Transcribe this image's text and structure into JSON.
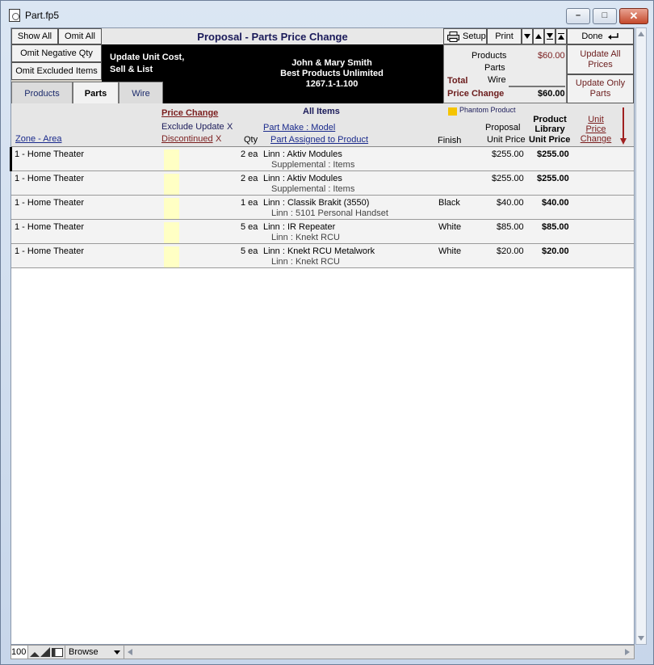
{
  "window": {
    "title": "Part.fp5",
    "min_glyph": "–",
    "max_glyph": "□",
    "close_glyph": "✕"
  },
  "toolbar": {
    "show_all": "Show All",
    "omit_all": "Omit All",
    "omit_negative": "Omit Negative Qty",
    "omit_excluded": "Omit Excluded Items",
    "title": "Proposal - Parts Price Change",
    "setup": "Setup",
    "print": "Print",
    "done": "Done",
    "update_all": "Update All Prices",
    "update_parts": "Update Only Parts"
  },
  "panel": {
    "update_text_1": "Update Unit Cost,",
    "update_text_2": "Sell & List",
    "client_name": "John & Mary Smith",
    "company": "Best Products Unlimited",
    "proposal_no": "1267.1-1.100"
  },
  "totals": {
    "products_label": "Products",
    "products_value": "$60.00",
    "parts_label": "Parts",
    "total_label": "Total",
    "wire_label": "Wire",
    "price_change_label": "Price Change",
    "price_change_value": "$60.00"
  },
  "tabs": [
    "Products",
    "Parts",
    "Wire"
  ],
  "columns": {
    "price_change": "Price Change",
    "all_items": "All Items",
    "phantom": "Phantom Product",
    "exclude_update": "Exclude Update",
    "exclude_x": "X",
    "part_make_model": "Part Make : Model",
    "proposal": "Proposal",
    "product_library": "Product Library",
    "unit_price_change": "Unit Price Change",
    "zone_area": "Zone -  Area",
    "discontinued": "Discontinued",
    "discontinued_x": "X",
    "qty": "Qty",
    "part_assigned": "Part Assigned to Product",
    "finish": "Finish",
    "unit_price": "Unit Price",
    "library_unit_price": "Unit Price"
  },
  "rows": [
    {
      "zone": "1 - Home Theater",
      "qty": "2 ea",
      "part": "Linn : Aktiv Modules",
      "assigned": "Supplemental : Items",
      "finish": "",
      "proposal_price": "$255.00",
      "library_price": "$255.00"
    },
    {
      "zone": "1 - Home Theater",
      "qty": "2 ea",
      "part": "Linn : Aktiv Modules",
      "assigned": "Supplemental : Items",
      "finish": "",
      "proposal_price": "$255.00",
      "library_price": "$255.00"
    },
    {
      "zone": "1 - Home Theater",
      "qty": "1 ea",
      "part": "Linn : Classik Brakit (3550)",
      "assigned": "Linn : 5101 Personal Handset",
      "finish": "Black",
      "proposal_price": "$40.00",
      "library_price": "$40.00"
    },
    {
      "zone": "1 - Home Theater",
      "qty": "5 ea",
      "part": "Linn : IR Repeater",
      "assigned": "Linn : Knekt RCU",
      "finish": "White",
      "proposal_price": "$85.00",
      "library_price": "$85.00"
    },
    {
      "zone": "1 - Home Theater",
      "qty": "5 ea",
      "part": "Linn : Knekt RCU Metalwork",
      "assigned": "Linn : Knekt RCU",
      "finish": "White",
      "proposal_price": "$20.00",
      "library_price": "$20.00"
    }
  ],
  "status": {
    "zoom": "100",
    "mode": "Browse"
  },
  "colors": {
    "phantom_swatch": "#f5c400",
    "accent_maroon": "#7a1d1d",
    "navy": "#1b1b5a"
  }
}
